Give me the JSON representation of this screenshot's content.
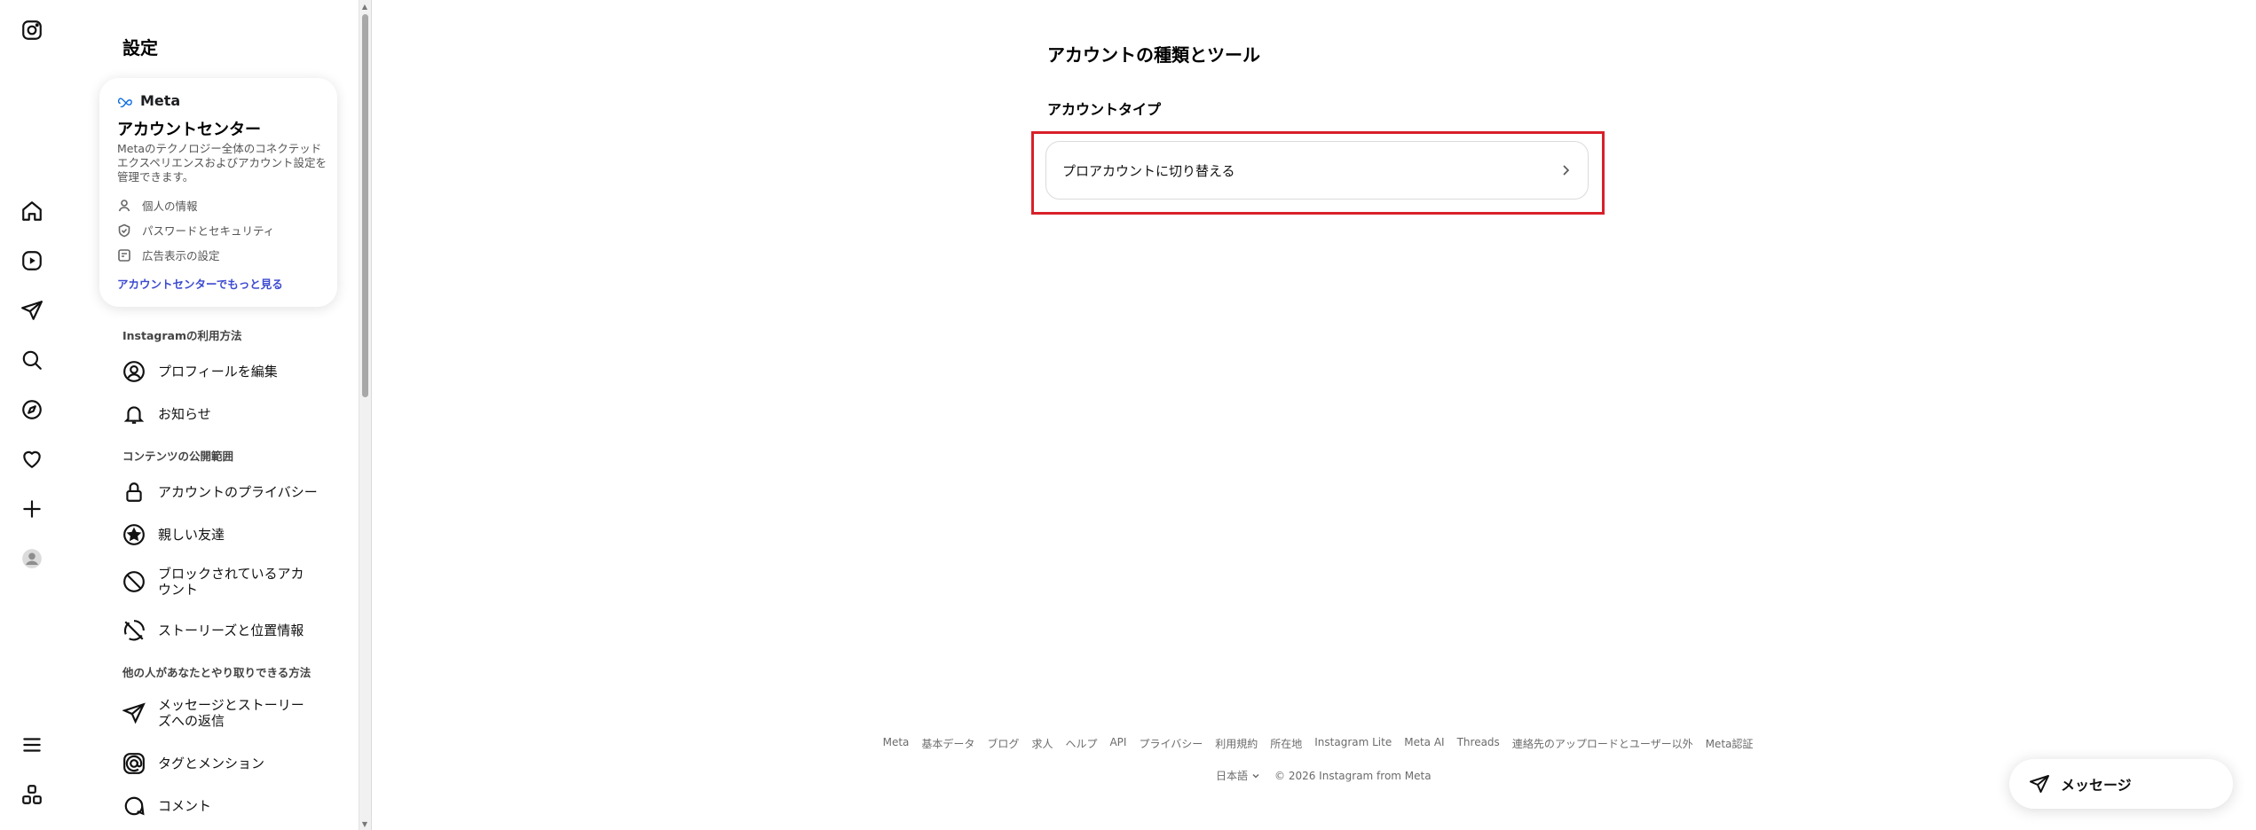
{
  "settings": {
    "title": "設定"
  },
  "account_center": {
    "brand": "Meta",
    "title": "アカウントセンター",
    "description": "Metaのテクノロジー全体のコネクテッドエクスペリエンスおよびアカウント設定を管理できます。",
    "items": [
      {
        "label": "個人の情報",
        "icon": "person-icon"
      },
      {
        "label": "パスワードとセキュリティ",
        "icon": "shield-check-icon"
      },
      {
        "label": "広告表示の設定",
        "icon": "ad-icon"
      }
    ],
    "more_link": "アカウントセンターでもっと見る"
  },
  "sections": {
    "usage": "Instagramの利用方法",
    "visibility": "コンテンツの公開範囲",
    "interaction": "他の人があなたとやり取りできる方法"
  },
  "menu": {
    "edit_profile": "プロフィールを編集",
    "notifications": "お知らせ",
    "account_privacy": "アカウントのプライバシー",
    "close_friends": "親しい友達",
    "blocked": "ブロックされているアカウント",
    "story_location": "ストーリーズと位置情報",
    "messages_replies": "メッセージとストーリーズへの返信",
    "tags_mentions": "タグとメンション",
    "comments": "コメント"
  },
  "main": {
    "title": "アカウントの種類とツール",
    "subtitle": "アカウントタイプ",
    "switch_label": "プロアカウントに切り替える"
  },
  "footer": {
    "links": [
      "Meta",
      "基本データ",
      "ブログ",
      "求人",
      "ヘルプ",
      "API",
      "プライバシー",
      "利用規約",
      "所在地",
      "Instagram Lite",
      "Meta AI",
      "Threads",
      "連絡先のアップロードとユーザー以外",
      "Meta認証"
    ],
    "language": "日本語",
    "copyright": "© 2026 Instagram from Meta"
  },
  "messages_button": {
    "label": "メッセージ"
  },
  "colors": {
    "highlight": "#d8202a",
    "link": "#3d4bd1"
  }
}
